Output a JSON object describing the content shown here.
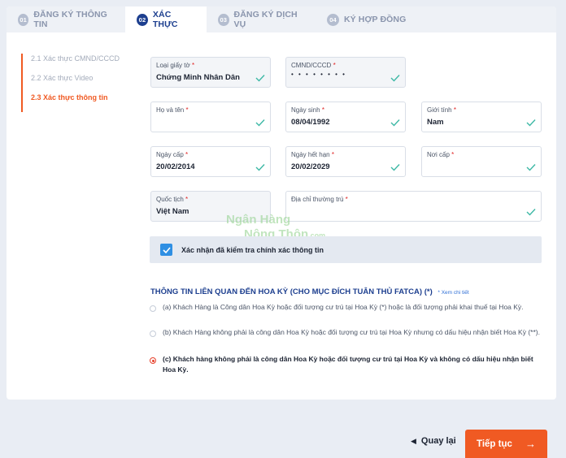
{
  "tabs": [
    {
      "num": "01",
      "label": "ĐĂNG KÝ THÔNG TIN"
    },
    {
      "num": "02",
      "label": "XÁC THỰC"
    },
    {
      "num": "03",
      "label": "ĐĂNG KÝ DỊCH VỤ"
    },
    {
      "num": "04",
      "label": "KÝ HỢP ĐỒNG"
    }
  ],
  "steps": [
    {
      "label": "2.1 Xác thực CMND/CCCD"
    },
    {
      "label": "2.2 Xác thực Video"
    },
    {
      "label": "2.3 Xác thực thông tin"
    }
  ],
  "fields": {
    "id_type": {
      "label": "Loại giấy tờ",
      "value": "Chứng Minh Nhân Dân"
    },
    "id_number": {
      "label": "CMND/CCCD",
      "value": "• • • • • • • •"
    },
    "full_name": {
      "label": "Họ và tên",
      "value": ""
    },
    "dob": {
      "label": "Ngày sinh",
      "value": "08/04/1992"
    },
    "gender": {
      "label": "Giới tính",
      "value": "Nam"
    },
    "issue_date": {
      "label": "Ngày cấp",
      "value": "20/02/2014"
    },
    "expiry_date": {
      "label": "Ngày hết hạn",
      "value": "20/02/2029"
    },
    "issue_place": {
      "label": "Nơi cấp",
      "value": ""
    },
    "nationality": {
      "label": "Quốc tịch",
      "value": "Việt Nam"
    },
    "address": {
      "label": "Địa chỉ thường trú",
      "value": ""
    }
  },
  "required_mark": "*",
  "confirm": {
    "label": "Xác nhận đã kiểm tra chính xác thông tin",
    "checked": true
  },
  "fatca": {
    "title": "THÔNG TIN LIÊN QUAN ĐẾN HOA KỲ (CHO MỤC ĐÍCH TUÂN THỦ FATCA) (*)",
    "link": "* Xem chi tiết",
    "options": [
      {
        "text": "(a) Khách Hàng là Công dân Hoa Kỳ hoặc đối tượng cư trú tại Hoa Kỳ (*) hoặc là đối tượng phải khai thuế tại Hoa Kỳ.",
        "selected": false
      },
      {
        "text": "(b) Khách Hàng không phải là công dân Hoa Kỳ hoặc đối tượng cư trú tại Hoa Kỳ nhưng có dấu hiệu nhận biết Hoa Kỳ (**).",
        "selected": false
      },
      {
        "text": "(c) Khách hàng không phải là công dân Hoa Kỳ hoặc đối tượng cư trú tại Hoa Kỳ và không có dấu hiệu nhận biết Hoa Kỳ.",
        "selected": true
      }
    ]
  },
  "watermark": {
    "line1": "Ngân Hàng",
    "line2": "Nông Thôn",
    "suffix": ".com"
  },
  "actions": {
    "back": "Quay lại",
    "next": "Tiếp tục"
  },
  "colors": {
    "primary": "#1d3f8f",
    "accent": "#f05a23",
    "check": "#2f8fe3"
  }
}
